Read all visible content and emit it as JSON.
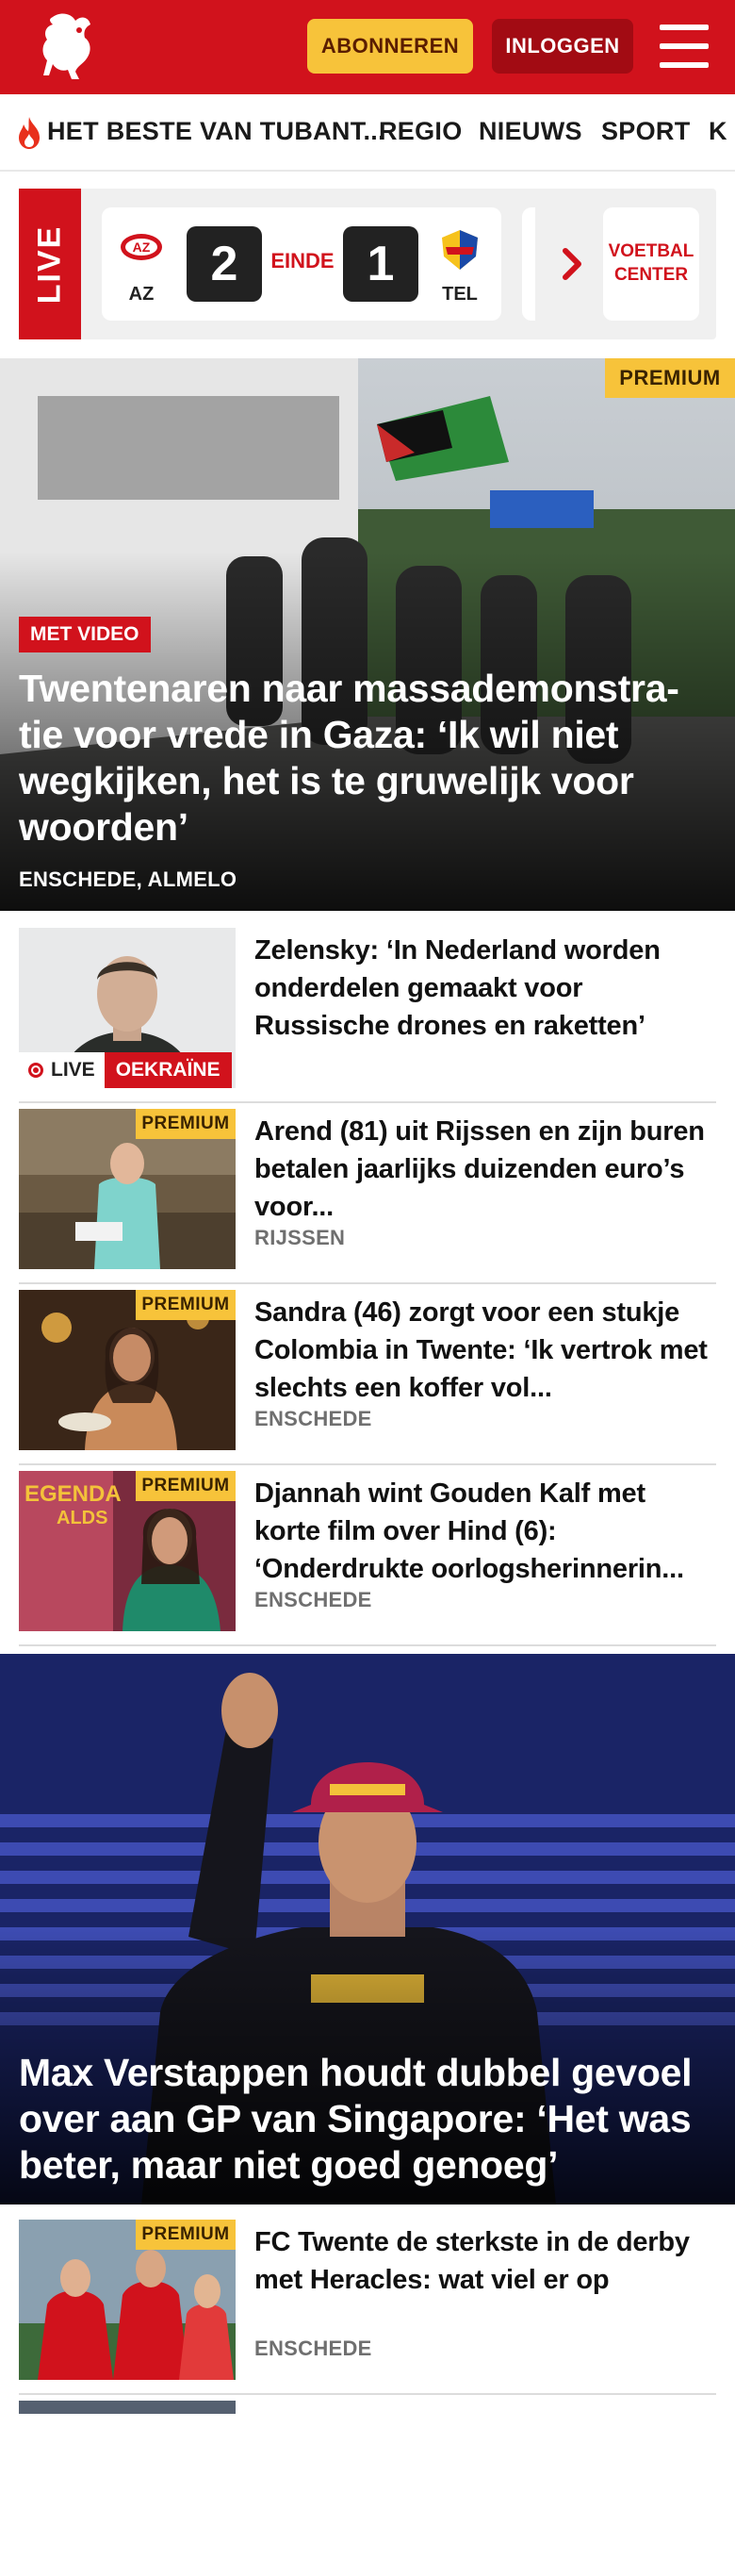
{
  "header": {
    "subscribe_label": "ABONNEREN",
    "login_label": "INLOGGEN",
    "brand_color": "#d1121c",
    "accent_color": "#f7c33a"
  },
  "nav": {
    "items": [
      {
        "label": "HET BESTE VAN TUBANT..."
      },
      {
        "label": "REGIO"
      },
      {
        "label": "NIEUWS"
      },
      {
        "label": "SPORT"
      },
      {
        "label": "K"
      }
    ]
  },
  "live_widget": {
    "tag": "LIVE",
    "home_team": "AZ",
    "away_team": "TEL",
    "home_score": "2",
    "away_score": "1",
    "status": "EINDE",
    "center_label": "VOETBAL CENTER"
  },
  "hero": {
    "badge": "PREMIUM",
    "video_tag": "MET VIDEO",
    "title": "Twentenaren naar massademonstra-tie voor vrede in Gaza: ‘Ik wil niet wegkijken, het is te gruwelijk voor woorden’",
    "location": "ENSCHEDE, ALMELO"
  },
  "articles": [
    {
      "title": "Zelensky: ‘In Nederland worden onderdelen gemaakt voor Russische drones en raketten’",
      "live_label": "LIVE",
      "topic": "OEKRAÏNE",
      "location": ""
    },
    {
      "badge": "PREMIUM",
      "title": "Arend (81) uit Rijssen en zijn buren betalen jaarlijks duizenden euro’s voor...",
      "location": "RIJSSEN"
    },
    {
      "badge": "PREMIUM",
      "title": "Sandra (46) zorgt voor een stukje Colombia in Twente: ‘Ik vertrok met slechts een koffer vol...",
      "location": "ENSCHEDE"
    },
    {
      "badge": "PREMIUM",
      "title": "Djannah wint Gouden Kalf met korte film over Hind (6): ‘Onderdrukte oorlogsherinnerin...",
      "location": "ENSCHEDE"
    }
  ],
  "hero2": {
    "title": "Max Verstappen houdt dubbel gevoel over aan GP van Singapore: ‘Het was beter, maar niet goed genoeg’"
  },
  "articles2": [
    {
      "badge": "PREMIUM",
      "title": "FC Twente de sterkste in de derby met Heracles: wat viel er op",
      "location": "ENSCHEDE"
    }
  ]
}
